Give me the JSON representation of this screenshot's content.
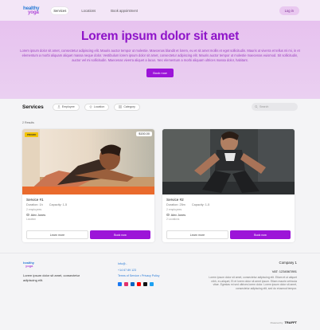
{
  "brand": {
    "line1": "healthy",
    "line2": "yoga"
  },
  "nav": {
    "items": [
      "Services",
      "Locations",
      "Book appointment"
    ],
    "login": "Log in"
  },
  "hero": {
    "title": "Lorem ipsum dolor sit amet",
    "text": "Lorem ipsum dolor sit amet, consectetur adipiscing elit. Mauris auctor tempor ut molestie. Maecenas blandit et lorem, eu et sit amet mollis et eget sollicitudin. Mauris ut viverra et tellus mi mi, in et elementum a morbi aliquam aliquet massa neque dolor. Vestibulum lorem ipsum dolor sit amet, consectetur adipiscing elit. Mauris auctor tempor ut molestie maecenas euismod. Sit sollicitudin, auctor vel mi sollicitudin. Maecenas viverra aliquet a lacus. Nec elementum a morbi aliquam ultrices massa dolor, habitant.",
    "button": "Book now"
  },
  "filters": {
    "title": "Services",
    "chips": [
      "Employee",
      "Location",
      "Category"
    ],
    "search_placeholder": "Search"
  },
  "results": "2 Results",
  "cards": [
    {
      "name": "Service #1",
      "duration_label": "Duration: 1h",
      "capacity_label": "Capacity: 1-5",
      "sub": "2 employees",
      "provider": "Alex Jones",
      "location": "Location",
      "price": "$150.00",
      "badge": "PROMO",
      "learn": "Learn more",
      "book": "Book now"
    },
    {
      "name": "Service #2",
      "duration_label": "Duration: 25m",
      "capacity_label": "Capacity: 1-5",
      "sub": "2 employees",
      "provider": "Alex Jones",
      "location": "2 Locations",
      "price": "",
      "badge": "",
      "learn": "Learn more",
      "book": "Book now"
    }
  ],
  "footer": {
    "tagline": "Lorem ipsum dolor sit amet, consectetur adipiscing elit.",
    "mid": [
      "Info@..",
      "+14 67 89 123",
      "Terms of Service • Privacy Policy"
    ],
    "company": "Company 1",
    "vat": "VAT: 1234567891",
    "address": "Lorem ipsum dolor sit amet, consectetur adipiscing elit. Etiam et ut aliquet nibh, eu aliquet, Et et lorem dolor sit amet ipsum. Etiam mauris vehicula vitae. Egestas mi sed ultrices lorem dolor. Lorem ipsum dolor sit amet, consectetur adipiscing elit, sed do eiusmod tempor.",
    "powered_label": "Powered by",
    "powered_brand": "TRAFFT",
    "social_colors": [
      "#1877f2",
      "#e1306c",
      "#0a66c2",
      "#ff0000",
      "#111111",
      "#1da1f2"
    ]
  },
  "colors": {
    "accent": "#9c14d8",
    "hero_bg": "#e7c2ef",
    "title": "#8f14c9"
  }
}
